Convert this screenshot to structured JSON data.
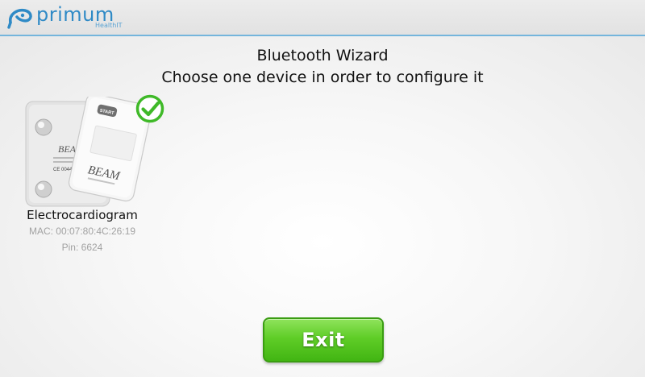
{
  "header": {
    "logo_text": "primum",
    "logo_subtext": "HealthIT"
  },
  "wizard": {
    "title": "Bluetooth Wizard",
    "subtitle": "Choose one device in order to configure it"
  },
  "devices": [
    {
      "name": "Electrocardiogram",
      "mac": "MAC: 00:07:80:4C:26:19",
      "pin": "Pin: 6624",
      "selected": true,
      "image_labels": {
        "start": "START",
        "brand": "BEAM",
        "brand_back": "BEAM",
        "ce_mark": "CE 0044"
      }
    }
  ],
  "footer": {
    "exit_label": "Exit"
  },
  "colors": {
    "brand_blue": "#2f8ac6",
    "header_border": "#74b5dc",
    "accent_green": "#5fcd27",
    "check_green": "#3fb928",
    "muted_text": "#a2a2a2"
  }
}
